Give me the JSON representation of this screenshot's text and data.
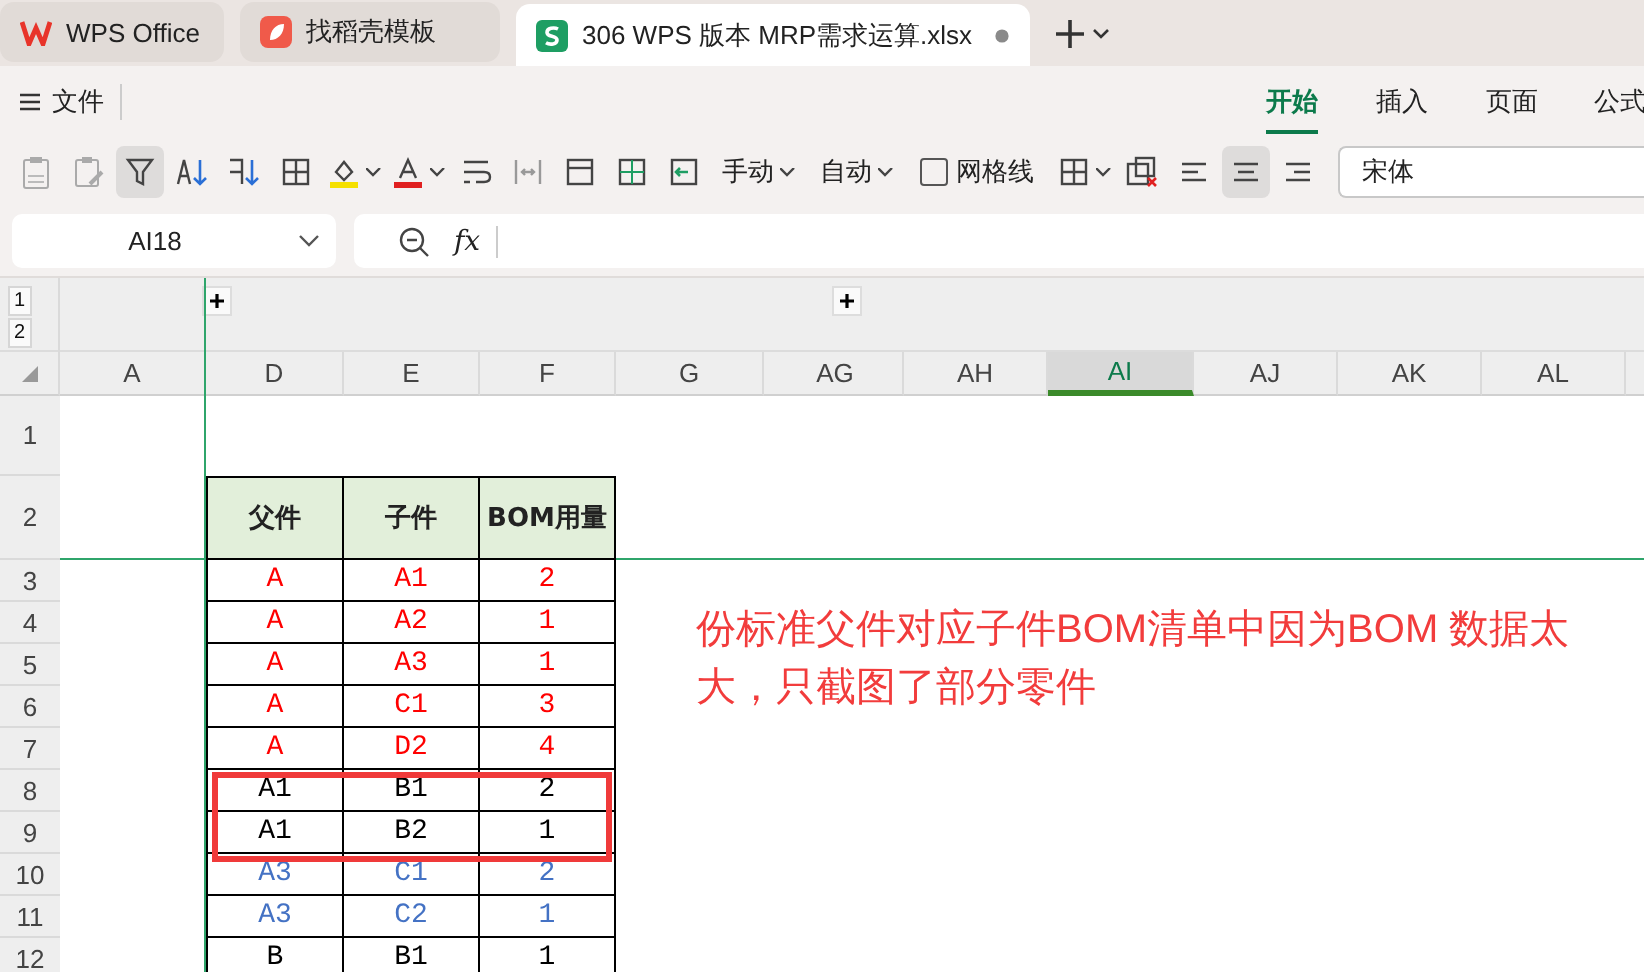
{
  "tabs": [
    {
      "label": "WPS Office",
      "kind": "home",
      "selected": false
    },
    {
      "label": "找稻壳模板",
      "kind": "template",
      "selected": false
    },
    {
      "label": "306 WPS 版本 MRP需求运算.xlsx",
      "kind": "sheet",
      "selected": true
    }
  ],
  "menu": {
    "file": "文件",
    "ribbon_tabs": [
      {
        "label": "开始",
        "selected": true
      },
      {
        "label": "插入",
        "selected": false
      },
      {
        "label": "页面",
        "selected": false
      },
      {
        "label": "公式",
        "selected": false
      }
    ]
  },
  "toolbar": {
    "filter_on": true,
    "row_height": "手动",
    "col_width": "自动",
    "gridlines": {
      "label": "网格线",
      "checked": false
    },
    "align_center_on": true,
    "font": "宋体"
  },
  "formula_bar": {
    "cell_ref": "AI18",
    "fx": "fx"
  },
  "outline": {
    "levels": [
      "1",
      "2"
    ]
  },
  "columns": [
    {
      "label": "A",
      "selected": false
    },
    {
      "label": "D",
      "selected": false
    },
    {
      "label": "E",
      "selected": false
    },
    {
      "label": "F",
      "selected": false
    },
    {
      "label": "G",
      "selected": false
    },
    {
      "label": "AG",
      "selected": false
    },
    {
      "label": "AH",
      "selected": false
    },
    {
      "label": "AI",
      "selected": true
    },
    {
      "label": "AJ",
      "selected": false
    },
    {
      "label": "AK",
      "selected": false
    },
    {
      "label": "AL",
      "selected": false
    }
  ],
  "row_numbers": [
    "1",
    "2",
    "3",
    "4",
    "5",
    "6",
    "7",
    "8",
    "9",
    "10",
    "11",
    "12"
  ],
  "table": {
    "header": [
      "父件",
      "子件",
      "BOM用量"
    ],
    "rows": [
      {
        "cells": [
          "A",
          "A1",
          "2"
        ],
        "color": "#ff0000",
        "highlighted": false
      },
      {
        "cells": [
          "A",
          "A2",
          "1"
        ],
        "color": "#ff0000",
        "highlighted": false
      },
      {
        "cells": [
          "A",
          "A3",
          "1"
        ],
        "color": "#ff0000",
        "highlighted": false
      },
      {
        "cells": [
          "A",
          "C1",
          "3"
        ],
        "color": "#ff0000",
        "highlighted": false
      },
      {
        "cells": [
          "A",
          "D2",
          "4"
        ],
        "color": "#ff0000",
        "highlighted": false
      },
      {
        "cells": [
          "A1",
          "B1",
          "2"
        ],
        "color": "#000000",
        "highlighted": true
      },
      {
        "cells": [
          "A1",
          "B2",
          "1"
        ],
        "color": "#000000",
        "highlighted": true
      },
      {
        "cells": [
          "A3",
          "C1",
          "2"
        ],
        "color": "#4472c4",
        "highlighted": false
      },
      {
        "cells": [
          "A3",
          "C2",
          "1"
        ],
        "color": "#4472c4",
        "highlighted": false
      },
      {
        "cells": [
          "B",
          "B1",
          "1"
        ],
        "color": "#000000",
        "highlighted": false
      }
    ]
  },
  "annotation": "份标准父件对应子件BOM清单中因为BOM 数据太大，只截图了部分零件"
}
